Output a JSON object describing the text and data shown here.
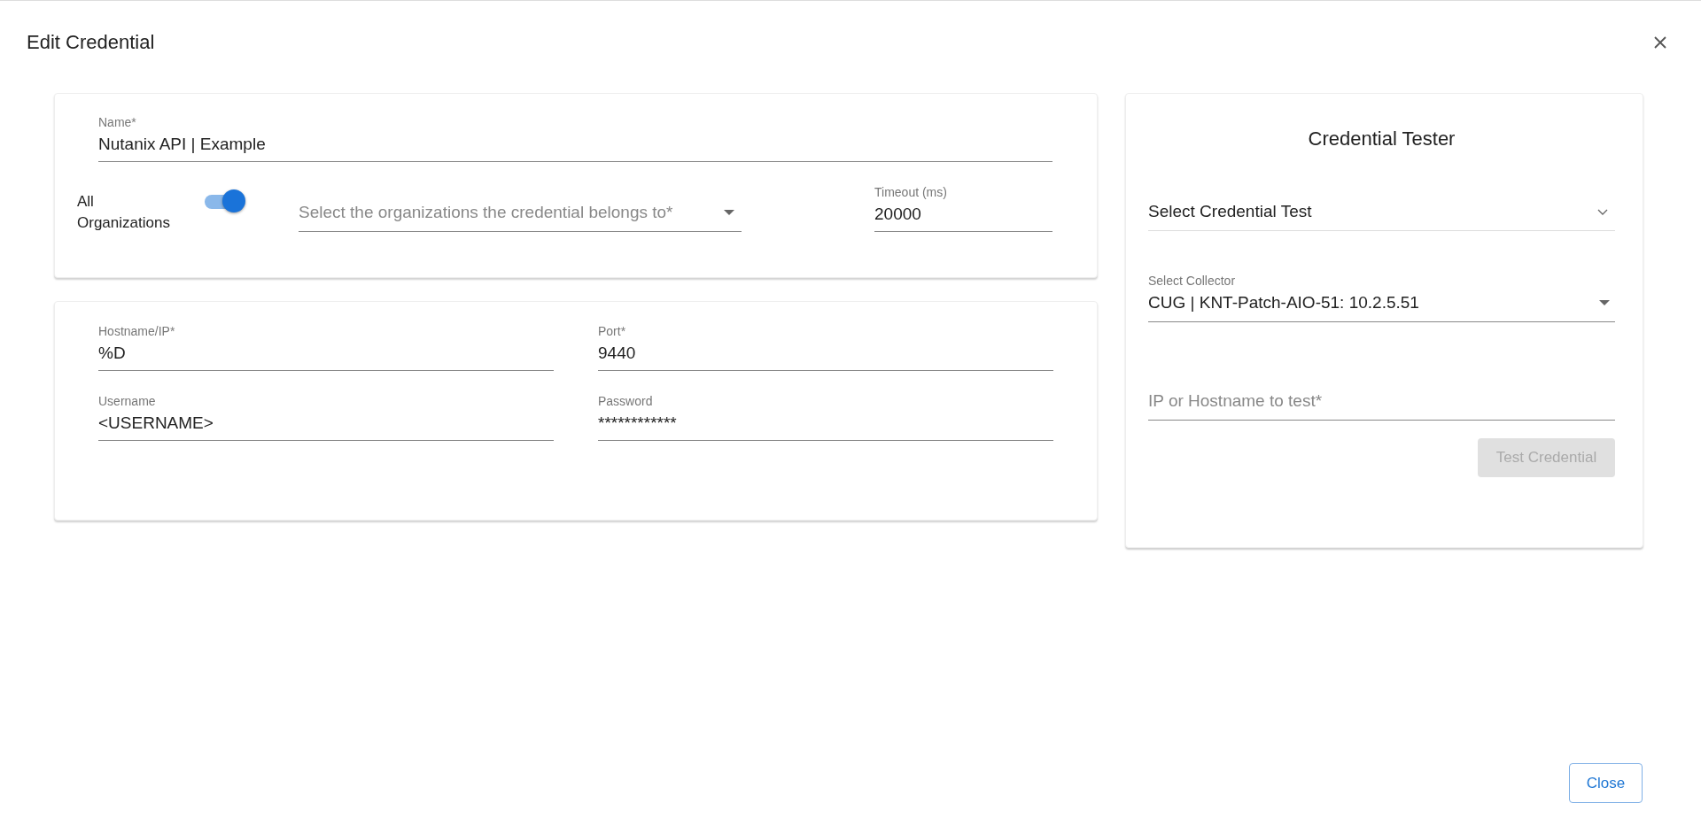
{
  "dialog": {
    "title": "Edit Credential"
  },
  "general": {
    "name": {
      "label": "Name*",
      "value": "Nutanix API | Example"
    },
    "all_organizations": {
      "label": "All Organizations",
      "on": true
    },
    "organizations": {
      "placeholder": "Select the organizations the credential belongs to*"
    },
    "timeout": {
      "label": "Timeout (ms)",
      "value": "20000"
    }
  },
  "connection": {
    "fields": [
      {
        "label": "Hostname/IP*",
        "value": "%D"
      },
      {
        "label": "Port*",
        "value": "9440"
      },
      {
        "label": "Username",
        "value": "<USERNAME>"
      },
      {
        "label": "Password",
        "value": "************"
      }
    ]
  },
  "tester": {
    "title": "Credential Tester",
    "credential_test": {
      "placeholder": "Select Credential Test"
    },
    "collector": {
      "label": "Select Collector",
      "value": "CUG | KNT-Patch-AIO-51: 10.2.5.51"
    },
    "target": {
      "placeholder": "IP or Hostname to test*"
    },
    "test_button": {
      "label": "Test Credential",
      "disabled": true
    }
  },
  "footer": {
    "close_button": "Close"
  }
}
